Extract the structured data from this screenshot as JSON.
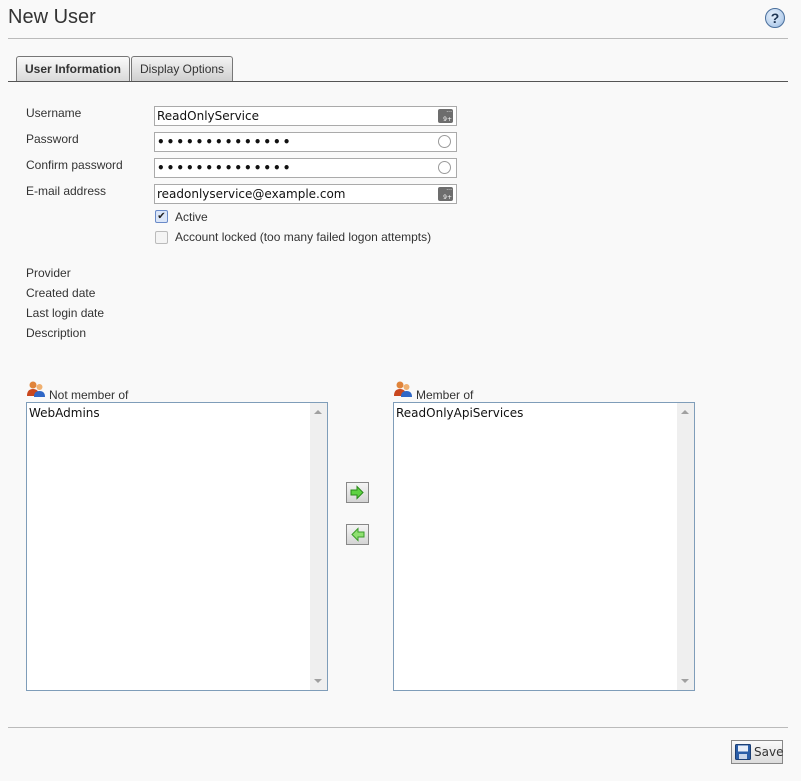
{
  "header": {
    "title": "New User",
    "help_label": "?"
  },
  "tabs": [
    {
      "label": "User Information",
      "active": true
    },
    {
      "label": "Display Options",
      "active": false
    }
  ],
  "form": {
    "username": {
      "label": "Username",
      "value": "ReadOnlyService",
      "icon": "keypad-icon"
    },
    "password": {
      "label": "Password",
      "value": "••••••••••••••",
      "icon": "password-reveal-icon"
    },
    "confirm_password": {
      "label": "Confirm password",
      "value": "••••••••••••••",
      "icon": "password-reveal-icon"
    },
    "email": {
      "label": "E-mail address",
      "value": "readonlyservice@example.com",
      "icon": "keypad-icon"
    },
    "active": {
      "label": "Active",
      "checked": true,
      "check_glyph": "✔"
    },
    "locked": {
      "label": "Account locked (too many failed logon attempts)",
      "checked": false
    }
  },
  "info": {
    "provider_label": "Provider",
    "created_label": "Created date",
    "last_login_label": "Last login date",
    "description_label": "Description"
  },
  "groups": {
    "not_member": {
      "label": "Not member of",
      "items": [
        "WebAdmins"
      ]
    },
    "member": {
      "label": "Member of",
      "items": [
        "ReadOnlyApiServices"
      ]
    }
  },
  "footer": {
    "save_label": "Save"
  },
  "colors": {
    "arrow_green": "#4cbb2e",
    "list_border": "#7f9db9",
    "save_icon_blue": "#2a5ea8"
  }
}
